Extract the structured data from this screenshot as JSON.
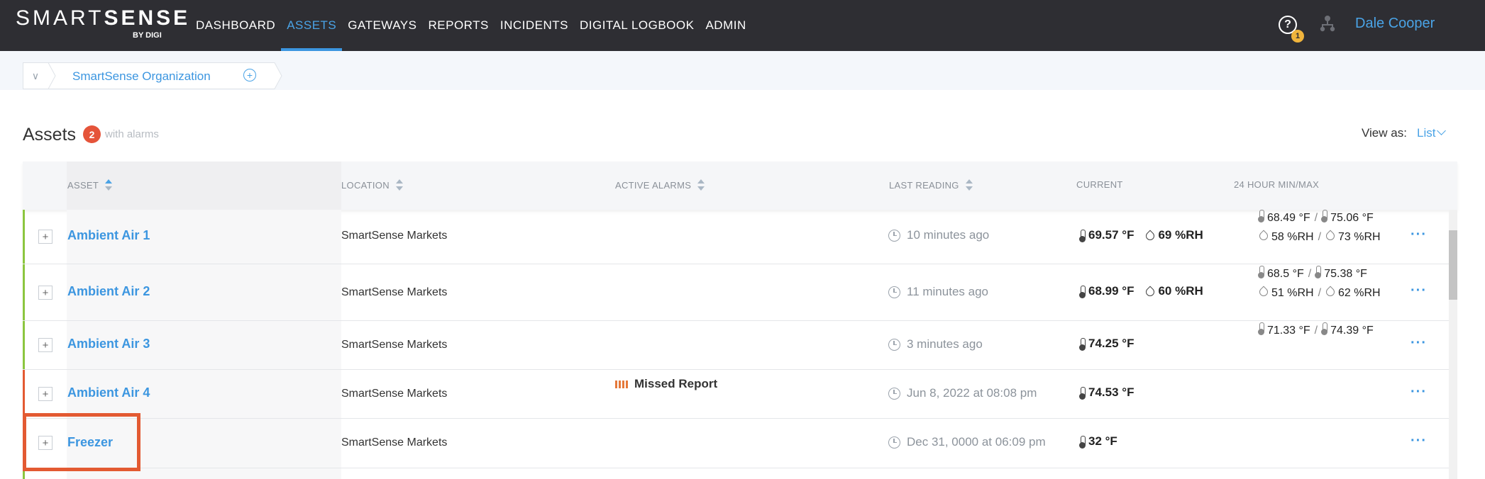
{
  "header": {
    "logo_main_thin": "SMART",
    "logo_main_bold": "SENSE",
    "logo_by": "BY ",
    "logo_digi": "DIGI",
    "nav": [
      {
        "label": "DASHBOARD",
        "active": false
      },
      {
        "label": "ASSETS",
        "active": true
      },
      {
        "label": "GATEWAYS",
        "active": false
      },
      {
        "label": "REPORTS",
        "active": false
      },
      {
        "label": "INCIDENTS",
        "active": false
      },
      {
        "label": "DIGITAL LOGBOOK",
        "active": false
      },
      {
        "label": "ADMIN",
        "active": false
      }
    ],
    "help_glyph": "?",
    "help_badge": "1",
    "user_name": "Dale Cooper"
  },
  "breadcrumb": {
    "toggle_glyph": "∨",
    "label": "SmartSense Organization",
    "add_glyph": "+"
  },
  "assets": {
    "title": "Assets",
    "alarm_count": "2",
    "alarm_text": "with alarms",
    "view_as_label": "View as:",
    "view_as_value": "List"
  },
  "table": {
    "columns": [
      "ASSET",
      "LOCATION",
      "ACTIVE ALARMS",
      "LAST READING",
      "CURRENT",
      "24 HOUR MIN/MAX"
    ],
    "rows": [
      {
        "name": "Ambient Air 1",
        "location": "SmartSense Markets",
        "alarm": "",
        "last": "10 minutes ago",
        "temp": "69.57 °F",
        "rh": "69 %RH",
        "min_t": "68.49 °F",
        "max_t": "75.06 °F",
        "min_rh": "58 %RH",
        "max_rh": "73 %RH",
        "status_color": "#8cc63f"
      },
      {
        "name": "Ambient Air 2",
        "location": "SmartSense Markets",
        "alarm": "",
        "last": "11 minutes ago",
        "temp": "68.99 °F",
        "rh": "60 %RH",
        "min_t": "68.5 °F",
        "max_t": "75.38 °F",
        "min_rh": "51 %RH",
        "max_rh": "62 %RH",
        "status_color": "#8cc63f"
      },
      {
        "name": "Ambient Air 3",
        "location": "SmartSense Markets",
        "alarm": "",
        "last": "3 minutes ago",
        "temp": "74.25 °F",
        "rh": "",
        "min_t": "71.33 °F",
        "max_t": "74.39 °F",
        "min_rh": "",
        "max_rh": "",
        "status_color": "#8cc63f"
      },
      {
        "name": "Ambient Air 4",
        "location": "SmartSense Markets",
        "alarm": "Missed Report",
        "last": "Jun 8, 2022 at 08:08 pm",
        "temp": "74.53 °F",
        "rh": "",
        "min_t": "",
        "max_t": "",
        "min_rh": "",
        "max_rh": "",
        "status_color": "#e35a32"
      },
      {
        "name": "Freezer",
        "location": "SmartSense Markets",
        "alarm": "",
        "last": "Dec 31, 0000 at 06:09 pm",
        "temp": "32 °F",
        "rh": "",
        "min_t": "",
        "max_t": "",
        "min_rh": "",
        "max_rh": "",
        "status_color": "#e35a32"
      }
    ],
    "expand_glyph": "+",
    "more_glyph": "···",
    "minmax_sep": "/"
  },
  "colors": {
    "accent": "#3c96e0",
    "nav_bg": "#2e2e33",
    "alarm_badge": "#e5543a",
    "highlight": "#e35a32"
  }
}
